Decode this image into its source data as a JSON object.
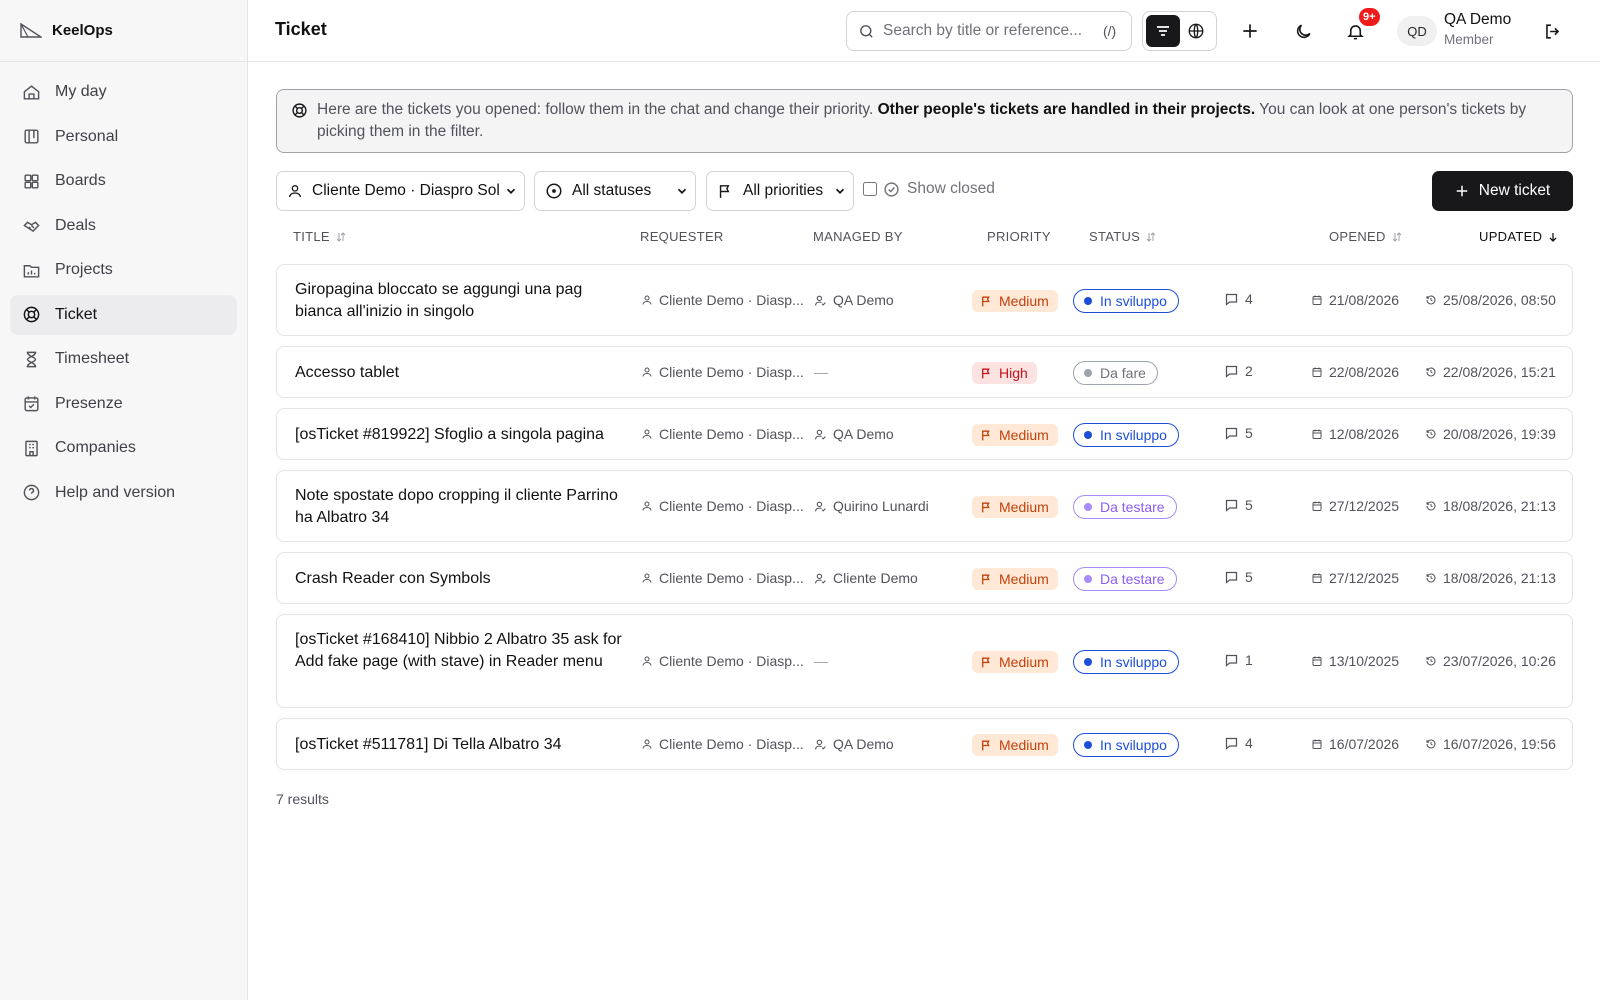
{
  "app": {
    "name": "KeelOps"
  },
  "sidebar": {
    "items": [
      {
        "label": "My day",
        "icon": "home-icon",
        "active": false
      },
      {
        "label": "Personal",
        "icon": "kanban-icon",
        "active": false
      },
      {
        "label": "Boards",
        "icon": "grid-icon",
        "active": false
      },
      {
        "label": "Deals",
        "icon": "handshake-icon",
        "active": false
      },
      {
        "label": "Projects",
        "icon": "folder-chart-icon",
        "active": false
      },
      {
        "label": "Ticket",
        "icon": "lifebuoy-icon",
        "active": true
      },
      {
        "label": "Timesheet",
        "icon": "hourglass-icon",
        "active": false
      },
      {
        "label": "Presenze",
        "icon": "calendar-check-icon",
        "active": false
      },
      {
        "label": "Companies",
        "icon": "building-icon",
        "active": false
      },
      {
        "label": "Help and version",
        "icon": "help-circle-icon",
        "active": false
      }
    ]
  },
  "header": {
    "title": "Ticket",
    "search_placeholder": "Search by title or reference...",
    "search_shortcut": "(/)",
    "notifications_badge": "9+",
    "user_initials": "QD",
    "user_name": "QA Demo",
    "user_role": "Member"
  },
  "info": {
    "text_before": "Here are the tickets you opened: follow them in the chat and change their priority. ",
    "text_bold": "Other people's tickets are handled in their projects.",
    "text_after": " You can look at one person's tickets by picking them in the filter."
  },
  "filters": {
    "requester": "Cliente Demo · Diaspro Sol",
    "status": "All statuses",
    "priority": "All priorities",
    "show_closed": "Show closed",
    "show_closed_checked": false,
    "new_ticket": "New ticket"
  },
  "columns": {
    "title": "TITLE",
    "requester": "REQUESTER",
    "managed_by": "MANAGED BY",
    "priority": "PRIORITY",
    "status": "STATUS",
    "opened": "OPENED",
    "updated": "UPDATED"
  },
  "tickets": [
    {
      "title": "Giropagina bloccato se aggungi una pag bianca all'inizio in singolo",
      "requester": "Cliente Demo · Diasp...",
      "managed_by": "QA Demo",
      "priority": "Medium",
      "status": "In sviluppo",
      "comments": "4",
      "opened": "21/08/2026",
      "updated": "25/08/2026, 08:50"
    },
    {
      "title": "Accesso tablet",
      "requester": "Cliente Demo · Diasp...",
      "managed_by": "—",
      "priority": "High",
      "status": "Da fare",
      "comments": "2",
      "opened": "22/08/2026",
      "updated": "22/08/2026, 15:21"
    },
    {
      "title": "[osTicket #819922] Sfoglio a singola pagina",
      "requester": "Cliente Demo · Diasp...",
      "managed_by": "QA Demo",
      "priority": "Medium",
      "status": "In sviluppo",
      "comments": "5",
      "opened": "12/08/2026",
      "updated": "20/08/2026, 19:39"
    },
    {
      "title": "Note spostate dopo cropping il cliente Parrino ha Albatro 34",
      "requester": "Cliente Demo · Diasp...",
      "managed_by": "Quirino Lunardi",
      "priority": "Medium",
      "status": "Da testare",
      "comments": "5",
      "opened": "27/12/2025",
      "updated": "18/08/2026, 21:13"
    },
    {
      "title": "Crash Reader con Symbols",
      "requester": "Cliente Demo · Diasp...",
      "managed_by": "Cliente Demo",
      "priority": "Medium",
      "status": "Da testare",
      "comments": "5",
      "opened": "27/12/2025",
      "updated": "18/08/2026, 21:13"
    },
    {
      "title": "[osTicket #168410] Nibbio 2 Albatro 35 ask for Add fake page (with stave) in Reader menu",
      "requester": "Cliente Demo · Diasp...",
      "managed_by": "—",
      "priority": "Medium",
      "status": "In sviluppo",
      "comments": "1",
      "opened": "13/10/2025",
      "updated": "23/07/2026, 10:26"
    },
    {
      "title": "[osTicket #511781] Di Tella Albatro 34",
      "requester": "Cliente Demo · Diasp...",
      "managed_by": "QA Demo",
      "priority": "Medium",
      "status": "In sviluppo",
      "comments": "4",
      "opened": "16/07/2026",
      "updated": "16/07/2026, 19:56"
    }
  ],
  "status_colors": {
    "In sviluppo": "#1d4ed8",
    "Da fare": "#9ca3af",
    "Da testare": "#a78bfa"
  },
  "results_label": "7 results"
}
